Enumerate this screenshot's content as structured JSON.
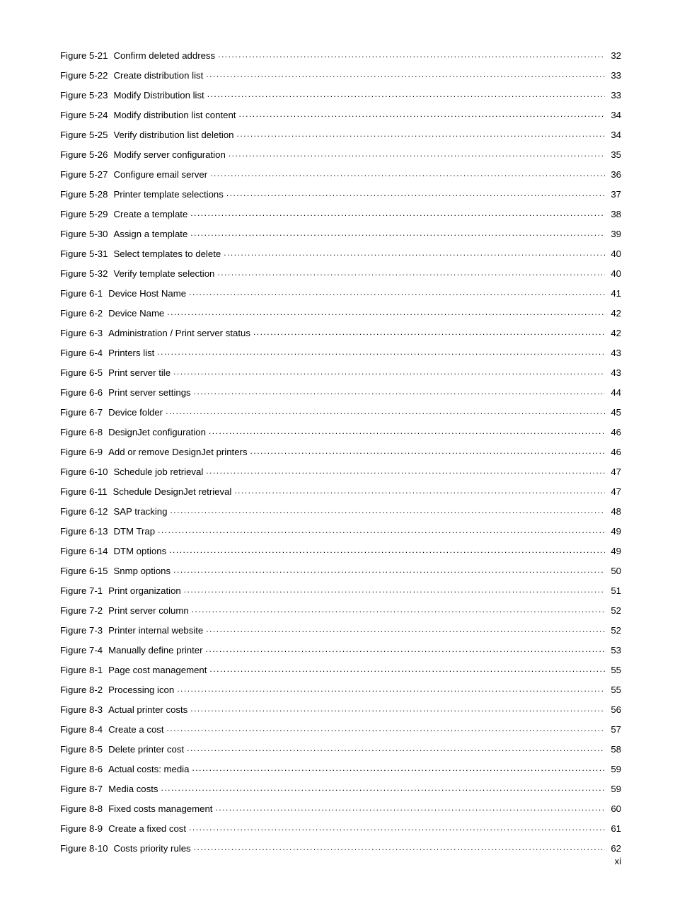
{
  "entries": [
    {
      "label": "Figure 5-21",
      "title": "Confirm deleted address",
      "page": "32"
    },
    {
      "label": "Figure 5-22",
      "title": "Create distribution list",
      "page": "33"
    },
    {
      "label": "Figure 5-23",
      "title": "Modify Distribution list",
      "page": "33"
    },
    {
      "label": "Figure 5-24",
      "title": "Modify distribution list content",
      "page": "34"
    },
    {
      "label": "Figure 5-25",
      "title": "Verify distribution list deletion",
      "page": "34"
    },
    {
      "label": "Figure 5-26",
      "title": "Modify server configuration",
      "page": "35"
    },
    {
      "label": "Figure 5-27",
      "title": "Configure email server",
      "page": "36"
    },
    {
      "label": "Figure 5-28",
      "title": "Printer template selections",
      "page": "37"
    },
    {
      "label": "Figure 5-29",
      "title": "Create a template",
      "page": "38"
    },
    {
      "label": "Figure 5-30",
      "title": "Assign a template",
      "page": "39"
    },
    {
      "label": "Figure 5-31",
      "title": "Select templates to delete",
      "page": "40"
    },
    {
      "label": "Figure 5-32",
      "title": "Verify template selection",
      "page": "40"
    },
    {
      "label": "Figure 6-1",
      "title": "Device Host Name",
      "page": "41"
    },
    {
      "label": "Figure 6-2",
      "title": "Device Name",
      "page": "42"
    },
    {
      "label": "Figure 6-3",
      "title": "Administration / Print server status",
      "page": "42"
    },
    {
      "label": "Figure 6-4",
      "title": "Printers list",
      "page": "43"
    },
    {
      "label": "Figure 6-5",
      "title": "Print server tile",
      "page": "43"
    },
    {
      "label": "Figure 6-6",
      "title": "Print server settings",
      "page": "44"
    },
    {
      "label": "Figure 6-7",
      "title": "Device folder",
      "page": "45"
    },
    {
      "label": "Figure 6-8",
      "title": "DesignJet configuration",
      "page": "46"
    },
    {
      "label": "Figure 6-9",
      "title": "Add or remove DesignJet printers",
      "page": "46"
    },
    {
      "label": "Figure 6-10",
      "title": "Schedule job retrieval",
      "page": "47"
    },
    {
      "label": "Figure 6-11",
      "title": "Schedule DesignJet retrieval",
      "page": "47"
    },
    {
      "label": "Figure 6-12",
      "title": "SAP tracking",
      "page": "48"
    },
    {
      "label": "Figure 6-13",
      "title": "DTM Trap",
      "page": "49"
    },
    {
      "label": "Figure 6-14",
      "title": "DTM options",
      "page": "49"
    },
    {
      "label": "Figure 6-15",
      "title": "Snmp options",
      "page": "50"
    },
    {
      "label": "Figure 7-1",
      "title": "Print organization",
      "page": "51"
    },
    {
      "label": "Figure 7-2",
      "title": "Print server column",
      "page": "52"
    },
    {
      "label": "Figure 7-3",
      "title": "Printer internal website",
      "page": "52"
    },
    {
      "label": "Figure 7-4",
      "title": "Manually define printer",
      "page": "53"
    },
    {
      "label": "Figure 8-1",
      "title": "Page cost management",
      "page": "55"
    },
    {
      "label": "Figure 8-2",
      "title": "Processing icon",
      "page": "55"
    },
    {
      "label": "Figure 8-3",
      "title": "Actual printer costs",
      "page": "56"
    },
    {
      "label": "Figure 8-4",
      "title": "Create a cost",
      "page": "57"
    },
    {
      "label": "Figure 8-5",
      "title": "Delete printer cost",
      "page": "58"
    },
    {
      "label": "Figure 8-6",
      "title": "Actual costs: media",
      "page": "59"
    },
    {
      "label": "Figure 8-7",
      "title": "Media costs",
      "page": "59"
    },
    {
      "label": "Figure 8-8",
      "title": "Fixed costs management",
      "page": "60"
    },
    {
      "label": "Figure 8-9",
      "title": "Create a fixed cost",
      "page": "61"
    },
    {
      "label": "Figure 8-10",
      "title": "Costs priority rules",
      "page": "62"
    }
  ],
  "page_number": "xi"
}
